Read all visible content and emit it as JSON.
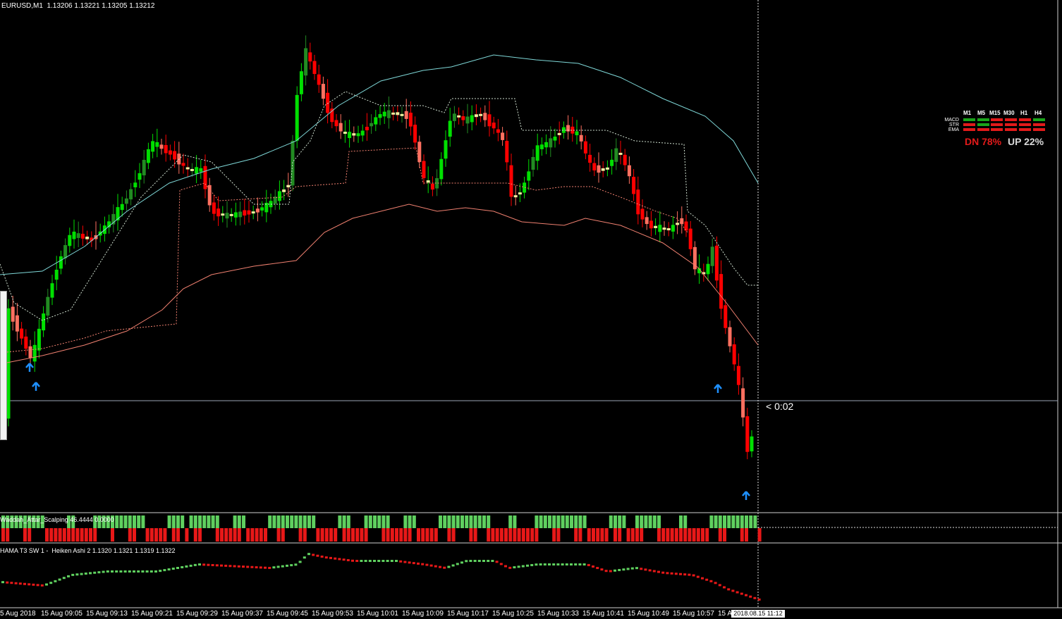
{
  "header": {
    "symbol_info": "EURUSD,M1  1.13206 1.13221 1.13205 1.13212"
  },
  "countdown": "< 0:02",
  "dashboard": {
    "timeframes": [
      "M1",
      "M5",
      "M15",
      "M30",
      "H1",
      "H4"
    ],
    "rows": [
      {
        "label": "MACD",
        "cells": [
          "#1aa51a",
          "#1aa51a",
          "#e21a1a",
          "#e21a1a",
          "#e21a1a",
          "#1aa51a"
        ]
      },
      {
        "label": "STR",
        "cells": [
          "#e21a1a",
          "#1aa51a",
          "#e21a1a",
          "#e21a1a",
          "#e21a1a",
          "#e21a1a"
        ]
      },
      {
        "label": "EMA",
        "cells": [
          "#e21a1a",
          "#e21a1a",
          "#e21a1a",
          "#e21a1a",
          "#e21a1a",
          "#e21a1a"
        ]
      }
    ],
    "dn_text": "DN 78%",
    "up_text": "UP 22%",
    "dn_color": "#e21a1a",
    "up_color": "#d8d8d8"
  },
  "indicator1": {
    "title": "Waddah_Attar_Scalping 46.4444 0.0000"
  },
  "indicator2": {
    "title": "HAMA T3 SW 1 -  Heiken Ashi 2 1.1320 1.1321 1.1319 1.1322"
  },
  "time_axis": {
    "labels": [
      "5 Aug 2018",
      "15 Aug 09:05",
      "15 Aug 09:13",
      "15 Aug 09:21",
      "15 Aug 09:29",
      "15 Aug 09:37",
      "15 Aug 09:45",
      "15 Aug 09:53",
      "15 Aug 10:01",
      "15 Aug 10:09",
      "15 Aug 10:17",
      "15 Aug 10:25",
      "15 Aug 10:33",
      "15 Aug 10:41",
      "15 Aug 10:49",
      "15 Aug 10:57",
      "15 A"
    ],
    "current_time": "2018.08.15 11:12"
  },
  "colors": {
    "bull_strong": "#00e000",
    "bull_weak": "#228b22",
    "bear_strong": "#ff0000",
    "bear_weak": "#ff7060",
    "doji": "#f0f0a0",
    "arrow": "#1e90ff",
    "ma_cyan": "#7fd8d8",
    "ma_salmon": "#f08070"
  }
}
